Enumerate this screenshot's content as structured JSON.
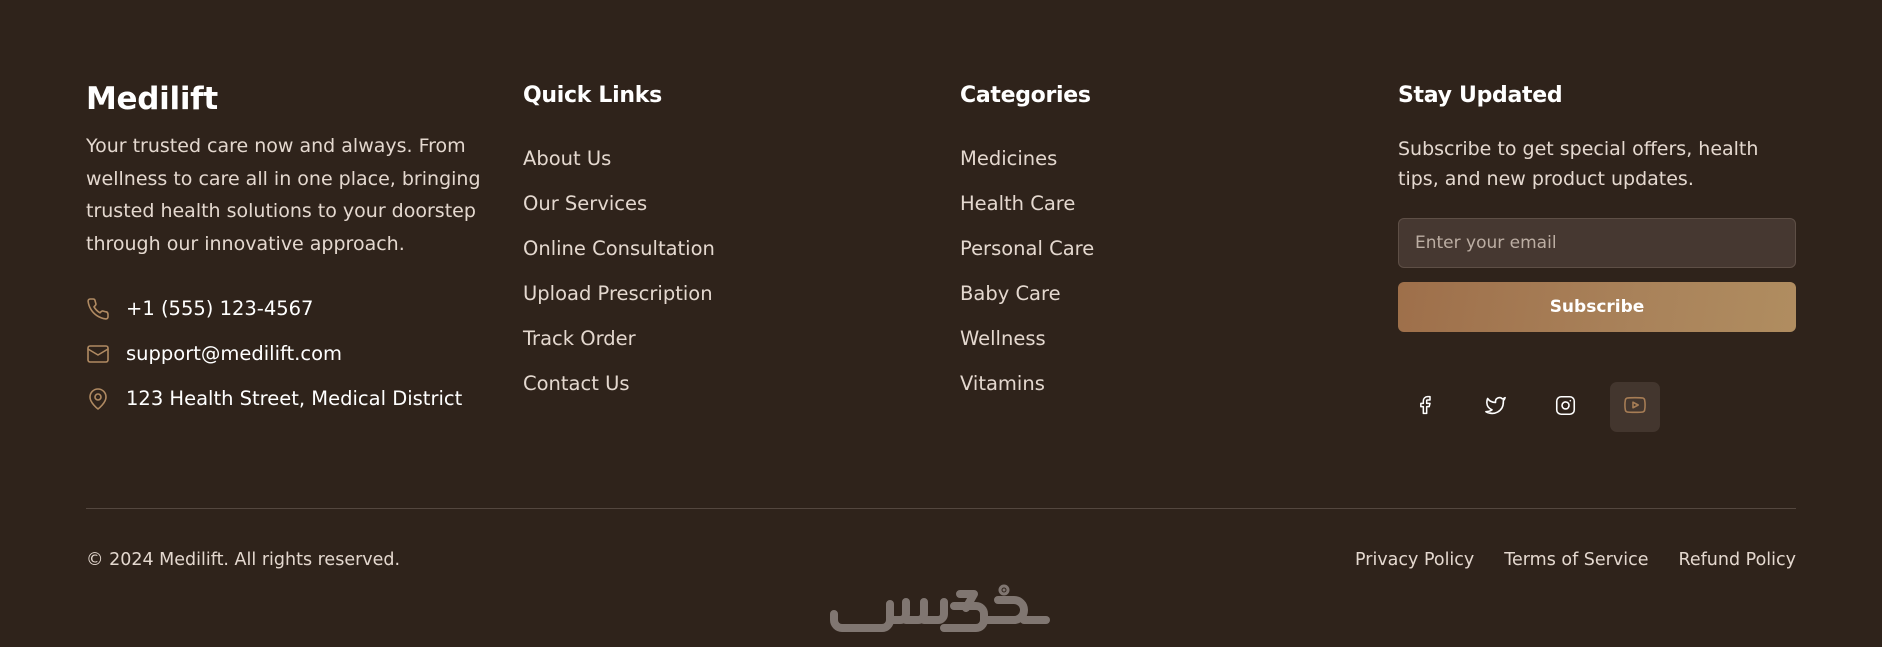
{
  "brand": {
    "name": "Medilift",
    "description": "Your trusted care now and always. From wellness to care all in one place, bringing trusted health solutions to your doorstep through our innovative approach.",
    "contacts": [
      {
        "icon": "phone-icon",
        "text": "+1 (555) 123-4567"
      },
      {
        "icon": "mail-icon",
        "text": "support@medilift.com"
      },
      {
        "icon": "map-pin-icon",
        "text": "123 Health Street, Medical District"
      }
    ]
  },
  "quick_links": {
    "title": "Quick Links",
    "items": [
      "About Us",
      "Our Services",
      "Online Consultation",
      "Upload Prescription",
      "Track Order",
      "Contact Us"
    ]
  },
  "categories": {
    "title": "Categories",
    "items": [
      "Medicines",
      "Health Care",
      "Personal Care",
      "Baby Care",
      "Wellness",
      "Vitamins"
    ]
  },
  "newsletter": {
    "title": "Stay Updated",
    "description": "Subscribe to get special offers, health tips, and new product updates.",
    "email_placeholder": "Enter your email",
    "subscribe_label": "Subscribe",
    "social": [
      "facebook-icon",
      "twitter-icon",
      "instagram-icon",
      "youtube-icon"
    ]
  },
  "bottom": {
    "copyright": "© 2024 Medilift. All rights reserved.",
    "legal_links": [
      "Privacy Policy",
      "Terms of Service",
      "Refund Policy"
    ]
  },
  "colors": {
    "background": "#2f231b",
    "accent": "#b08a62",
    "button_gradient_start": "#9e6f4a",
    "button_gradient_end": "#b08d60"
  }
}
